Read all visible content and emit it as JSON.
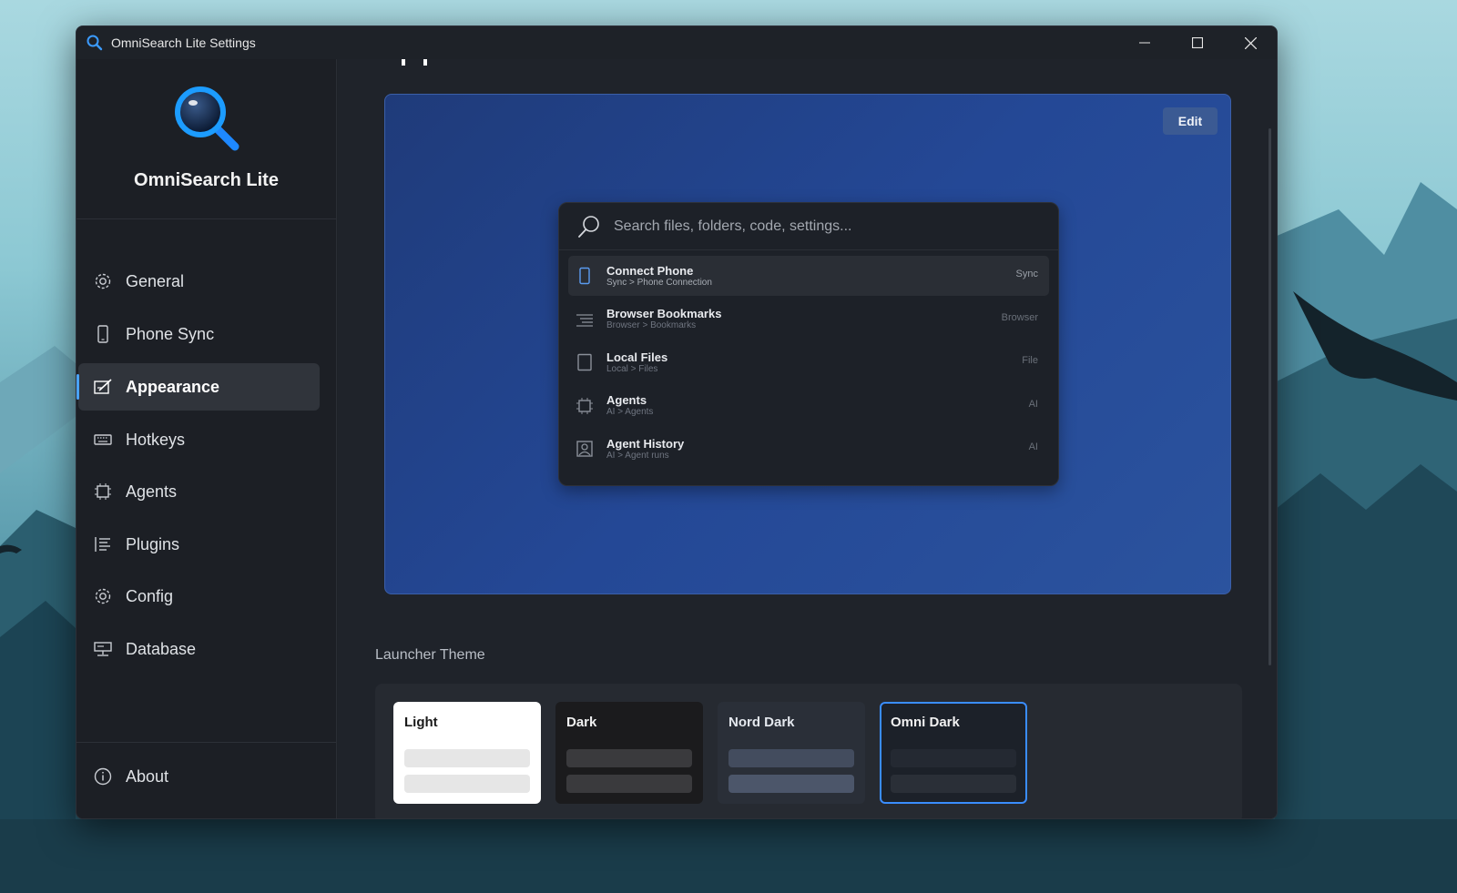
{
  "window": {
    "title": "OmniSearch Lite Settings"
  },
  "brand": {
    "name": "OmniSearch Lite"
  },
  "sidebar": {
    "items": [
      {
        "label": "General",
        "icon": "gear-icon"
      },
      {
        "label": "Phone Sync",
        "icon": "phone-icon"
      },
      {
        "label": "Appearance",
        "icon": "paint-icon",
        "active": true
      },
      {
        "label": "Hotkeys",
        "icon": "keyboard-icon"
      },
      {
        "label": "Agents",
        "icon": "chip-icon"
      },
      {
        "label": "Plugins",
        "icon": "list-icon"
      },
      {
        "label": "Config",
        "icon": "gear-icon"
      },
      {
        "label": "Database",
        "icon": "database-icon"
      }
    ],
    "about_label": "About"
  },
  "preview": {
    "edit_label": "Edit",
    "search_placeholder": "Search files, folders, code, settings...",
    "results": [
      {
        "title": "Connect Phone",
        "subtitle": "Sync > Phone Connection",
        "tag": "Sync",
        "icon": "phone-icon"
      },
      {
        "title": "Browser Bookmarks",
        "subtitle": "Browser > Bookmarks",
        "tag": "Browser",
        "icon": "bookmarks-icon"
      },
      {
        "title": "Local Files",
        "subtitle": "Local > Files",
        "tag": "File",
        "icon": "file-icon"
      },
      {
        "title": "Agents",
        "subtitle": "AI > Agents",
        "tag": "AI",
        "icon": "chip-icon"
      },
      {
        "title": "Agent History",
        "subtitle": "AI > Agent runs",
        "tag": "AI",
        "icon": "history-icon"
      }
    ]
  },
  "launcher_theme": {
    "label": "Launcher Theme",
    "themes": [
      {
        "name": "Light",
        "bg": "#ffffff",
        "text": "#1a1a1a",
        "bar": "#e6e6e6"
      },
      {
        "name": "Dark",
        "bg": "#1b1b1d",
        "text": "#f0f0f0",
        "bar": "#3a3a3d"
      },
      {
        "name": "Nord Dark",
        "bg": "#2a2f38",
        "text": "#e4e8ee",
        "bar": "#434c5e"
      },
      {
        "name": "Omni Dark",
        "bg": "#1c2129",
        "text": "#f2f2f2",
        "bar": "#2a2f37",
        "selected": true,
        "border": "#3a8dff"
      }
    ]
  },
  "colors": {
    "accent": "#4aa3ff",
    "preview_bg": "#244896",
    "window_bg": "#1e2228"
  }
}
